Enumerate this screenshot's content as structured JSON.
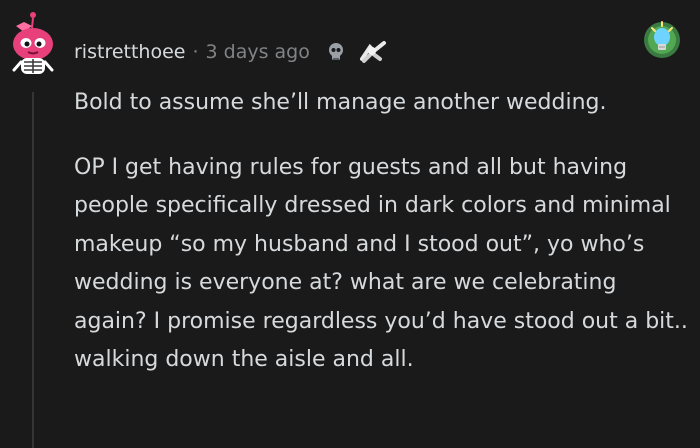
{
  "comment": {
    "username": "ristretthoee",
    "separator": "·",
    "timestamp": "3 days ago",
    "icons": {
      "avatar": "snoo-avatar-icon",
      "award_1": "silver-skull-award-icon",
      "award_2": "wholesome-seal-award-icon",
      "award_3": "lightbulb-award-icon"
    },
    "paragraphs": [
      "Bold to assume she’ll manage another wedding.",
      "OP I get having rules for guests and all but having people specifically dressed in dark colors and minimal makeup “so my husband and I stood out”, yo who’s wedding is everyone at? what are we celebrating again? I promise regardless you’d have stood out a bit.. walking down the aisle and all."
    ]
  },
  "colors": {
    "background": "#1a1a1b",
    "text": "#d7dadc",
    "meta": "#818384",
    "thread_line": "#343536",
    "avatar_accent": "#e8407a"
  }
}
